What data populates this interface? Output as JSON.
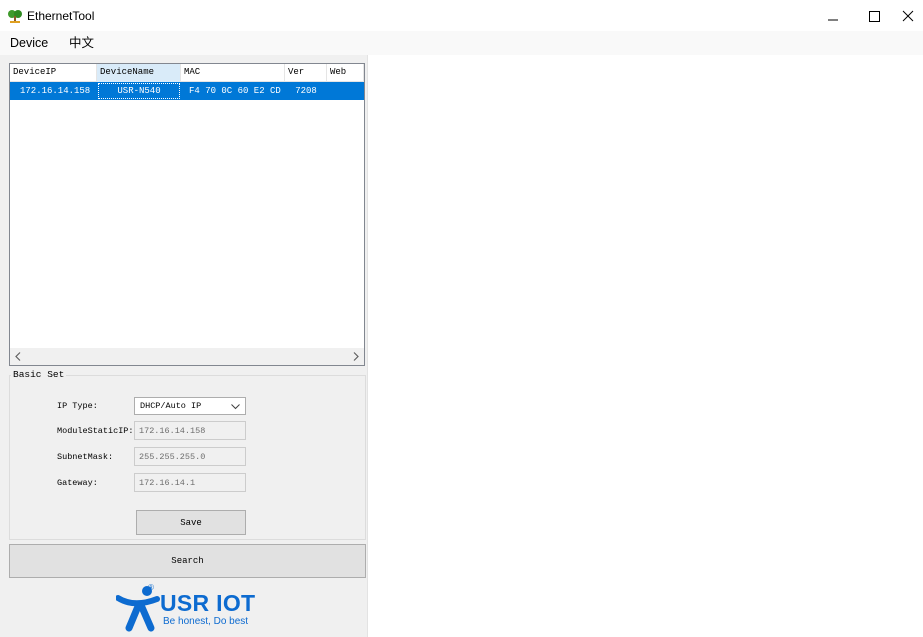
{
  "window": {
    "title": "EthernetTool",
    "app_icon": "ethernettool-app-icon",
    "controls": {
      "minimize": "minimize-icon",
      "maximize": "maximize-icon",
      "close": "close-icon"
    }
  },
  "menu": {
    "items": [
      "Device",
      "中文"
    ]
  },
  "device_table": {
    "columns": [
      "DeviceIP",
      "DeviceName",
      "MAC",
      "Ver",
      "Web"
    ],
    "highlighted_column": "DeviceName",
    "rows": [
      [
        "172.16.14.158",
        "USR-N540",
        "F4 70 0C 60 E2 CD",
        "7208",
        ""
      ]
    ],
    "selected_row": 0,
    "scroll_left_icon": "chevron-left-icon",
    "scroll_right_icon": "chevron-right-icon"
  },
  "basic_set": {
    "title": "Basic Set",
    "ip_type": {
      "label": "IP Type:",
      "value": "DHCP/Auto IP",
      "icon": "chevron-down-icon"
    },
    "module_static_ip": {
      "label": "ModuleStaticIP:",
      "value": "172.16.14.158",
      "enabled": false
    },
    "subnet_mask": {
      "label": "SubnetMask:",
      "value": "255.255.255.0",
      "enabled": false
    },
    "gateway": {
      "label": "Gateway:",
      "value": "172.16.14.1",
      "enabled": false
    },
    "save_label": "Save"
  },
  "search_label": "Search",
  "logo": {
    "brand": "USR IOT",
    "tagline": "Be honest, Do best",
    "registered_mark": "®"
  },
  "colors": {
    "selection": "#0078d7",
    "header_highlight": "#d9ebf9",
    "logo_blue": "#0d6bd0",
    "panel_background": "#f0f0f0"
  }
}
